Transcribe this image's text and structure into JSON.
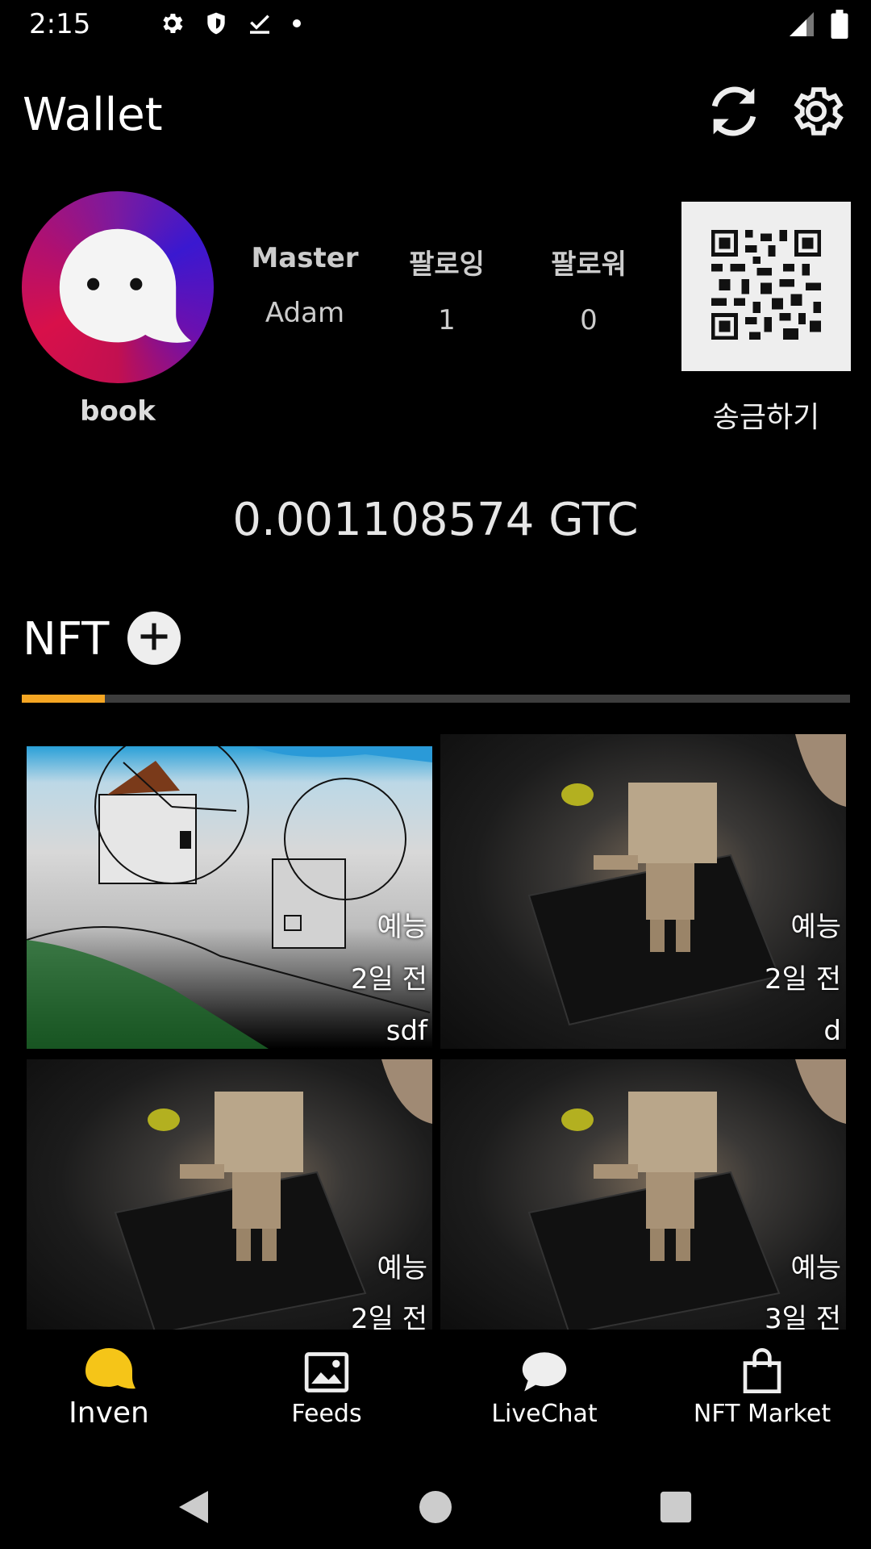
{
  "status_bar": {
    "time": "2:15",
    "icons": [
      "gear-icon",
      "shield-icon",
      "download-check-icon",
      "dot-icon"
    ],
    "right_icons": [
      "signal-icon",
      "battery-icon"
    ]
  },
  "header": {
    "title": "Wallet",
    "refresh_icon": "refresh-icon",
    "settings_icon": "gear-icon"
  },
  "profile": {
    "username": "book",
    "stats": [
      {
        "label": "Master",
        "value": "Adam"
      },
      {
        "label": "팔로잉",
        "value": "1"
      },
      {
        "label": "팔로워",
        "value": "0"
      }
    ],
    "send_label": "송금하기"
  },
  "wallet": {
    "balance": "0.001108574 GTC"
  },
  "nft": {
    "title": "NFT",
    "add_icon": "plus-circle-icon",
    "tab_progress_percent": 10,
    "items": [
      {
        "category": "예능",
        "time": "2일 전",
        "name": "sdf"
      },
      {
        "category": "예능",
        "time": "2일 전",
        "name": "d"
      },
      {
        "category": "예능",
        "time": "2일 전",
        "name": ""
      },
      {
        "category": "예능",
        "time": "3일 전",
        "name": ""
      }
    ]
  },
  "bottom_nav": {
    "items": [
      {
        "label": "Inven",
        "icon": "chat-bubble-icon",
        "active": true
      },
      {
        "label": "Feeds",
        "icon": "image-icon",
        "active": false
      },
      {
        "label": "LiveChat",
        "icon": "speech-bubble-icon",
        "active": false
      },
      {
        "label": "NFT Market",
        "icon": "shopping-bag-icon",
        "active": false
      }
    ]
  },
  "colors": {
    "accent": "#f5a623",
    "active_nav": "#f5c518",
    "background": "#000000"
  }
}
